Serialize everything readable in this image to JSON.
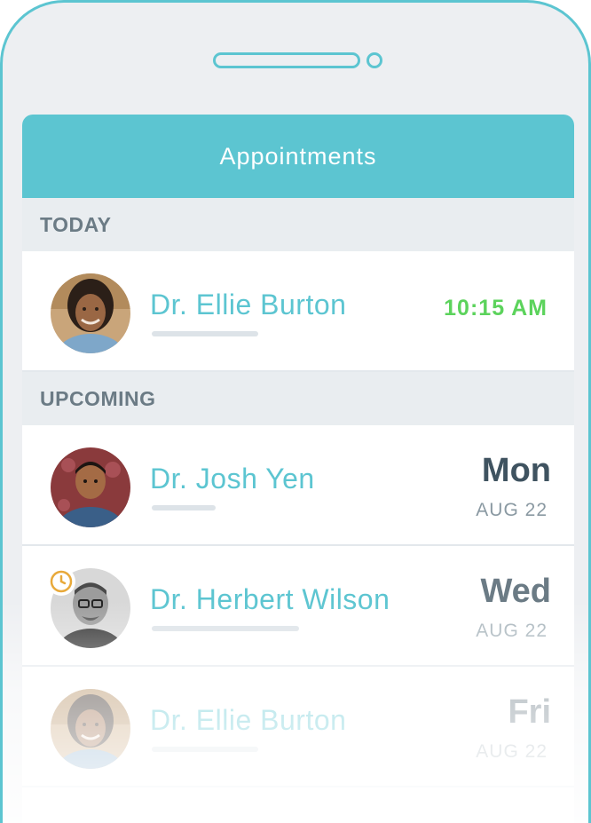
{
  "header": {
    "title": "Appointments"
  },
  "sections": {
    "today": {
      "label": "TODAY"
    },
    "upcoming": {
      "label": "UPCOMING"
    }
  },
  "today": [
    {
      "name": "Dr. Ellie Burton",
      "time": "10:15 AM",
      "avatar": "doctor-woman-avatar"
    }
  ],
  "upcoming": [
    {
      "name": "Dr. Josh Yen",
      "day": "Mon",
      "date": "AUG 22",
      "avatar": "doctor-man-avatar"
    },
    {
      "name": "Dr. Herbert Wilson",
      "day": "Wed",
      "date": "AUG 22",
      "avatar": "doctor-man-glasses-avatar",
      "badge": "clock-icon"
    },
    {
      "name": "Dr. Ellie Burton",
      "day": "Fri",
      "date": "AUG 22",
      "avatar": "doctor-woman-avatar"
    }
  ],
  "colors": {
    "accent": "#5cc5d1",
    "time": "#5cd35c",
    "day": "#3f5360",
    "badge": "#e8a93a"
  }
}
